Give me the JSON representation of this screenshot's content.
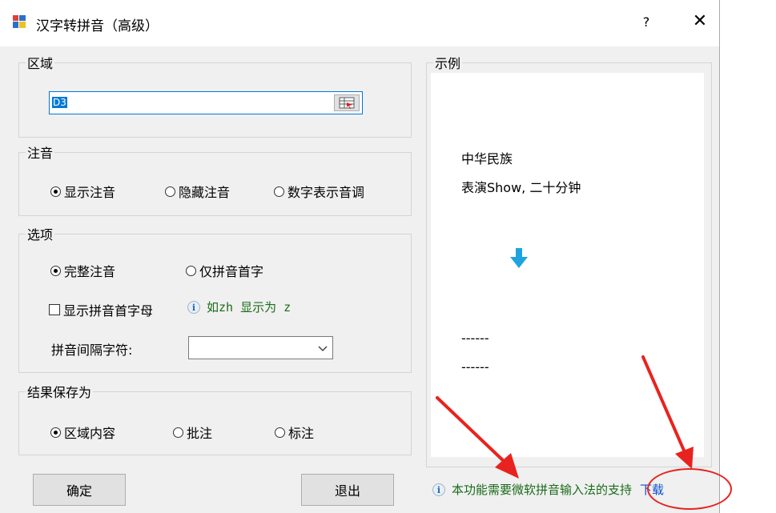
{
  "window": {
    "title": "汉字转拼音（高级）",
    "help_label": "?",
    "close_label": "✕"
  },
  "range_group": {
    "label": "区域",
    "value": "D3"
  },
  "phonetic_group": {
    "label": "注音",
    "options": [
      "显示注音",
      "隐藏注音",
      "数字表示音调"
    ],
    "selected": "显示注音"
  },
  "options_group": {
    "label": "选项",
    "radios": [
      "完整注音",
      "仅拼音首字"
    ],
    "selected": "完整注音",
    "checkbox_label": "显示拼音首字母",
    "checkbox_checked": false,
    "hint": "如zh 显示为 z",
    "separator_label": "拼音间隔字符:",
    "separator_value": ""
  },
  "save_group": {
    "label": "结果保存为",
    "options": [
      "区域内容",
      "批注",
      "标注"
    ],
    "selected": "区域内容"
  },
  "buttons": {
    "ok": "确定",
    "exit": "退出"
  },
  "example_group": {
    "label": "示例",
    "lines": [
      "中华民族",
      "表演Show, 二十分钟"
    ],
    "output_lines": [
      "------",
      "------"
    ]
  },
  "footer": {
    "notice": "本功能需要微软拼音输入法的支持",
    "link": "下载"
  },
  "icons": {
    "info": "info-icon",
    "arrow": "arrow-down-icon",
    "picker": "range-picker-icon",
    "dropdown": "chevron-down-icon",
    "app": "app-icon"
  },
  "colors": {
    "accent": "#0078d7",
    "hint_text": "#1a6b1a",
    "link": "#0b50d0",
    "annotation": "#e8231f",
    "arrow": "#1fa3e0"
  }
}
